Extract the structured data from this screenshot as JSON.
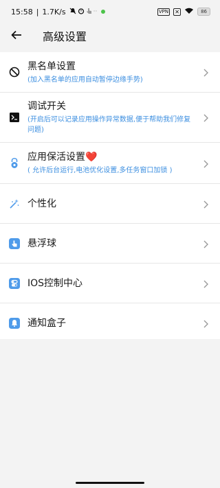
{
  "status_bar": {
    "time": "15:58",
    "speed": "1.7K/s",
    "separator": "|",
    "battery": "86",
    "vpn": "VPN"
  },
  "header": {
    "title": "高级设置",
    "back_icon": "arrow-left-icon"
  },
  "settings": {
    "items": [
      {
        "title": "黑名单设置",
        "desc": "(加入黑名单的应用自动暂停边缘手势)",
        "icon": "block-icon"
      },
      {
        "title": "调试开关",
        "desc": "(开启后可以记录应用操作异常数据,便于帮助我们修复问题)",
        "icon": "terminal-icon"
      },
      {
        "title": "应用保活设置❤️",
        "desc": "( 允许后台运行,电池优化设置,多任务窗口加锁 )",
        "icon": "lock-icon"
      },
      {
        "title": "个性化",
        "desc": "",
        "icon": "magic-wand-icon"
      },
      {
        "title": "悬浮球",
        "desc": "",
        "icon": "touch-hand-icon"
      },
      {
        "title": "IOS控制中心",
        "desc": "",
        "icon": "toggle-icon"
      },
      {
        "title": "通知盒子",
        "desc": "",
        "icon": "bell-icon"
      }
    ]
  },
  "colors": {
    "accent_blue": "#3d8fe0",
    "icon_blue": "#4f9bea",
    "background": "#f3f3f3",
    "card": "#ffffff"
  }
}
